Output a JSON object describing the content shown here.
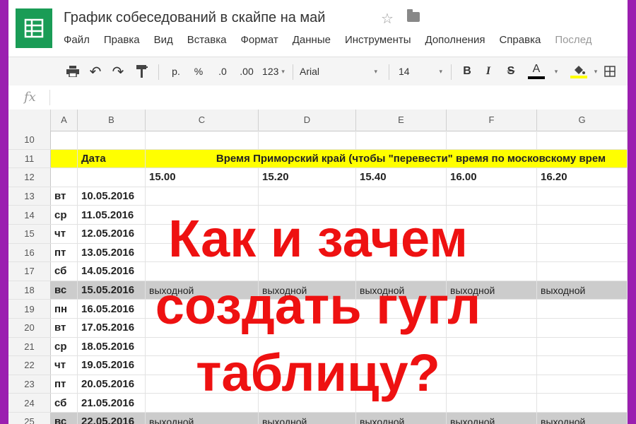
{
  "doc": {
    "title": "График собеседований в скайпе на май"
  },
  "menu": [
    "Файл",
    "Правка",
    "Вид",
    "Вставка",
    "Формат",
    "Данные",
    "Инструменты",
    "Дополнения",
    "Справка"
  ],
  "menu_last": "Послед",
  "toolbar": {
    "currency": "р.",
    "percent": "%",
    "dec_less": ".0",
    "dec_more": ".00",
    "number_format": "123",
    "font": "Arial",
    "font_size": "14",
    "bold": "B",
    "italic": "I",
    "strike": "S",
    "text_color": "A"
  },
  "formula_bar": {
    "fx": "fx"
  },
  "columns": [
    "A",
    "B",
    "C",
    "D",
    "E",
    "F",
    "G"
  ],
  "header_row": {
    "num": "11",
    "date_label": "Дата",
    "time_label": "Время Приморский край (чтобы \"перевести\" время по московскому врем"
  },
  "times_row": {
    "num": "12",
    "times": [
      "15.00",
      "15.20",
      "15.40",
      "16.00",
      "16.20"
    ]
  },
  "empty_row": {
    "num": "10"
  },
  "rows": [
    {
      "num": "13",
      "day": "вт",
      "date": "10.05.2016",
      "off": false
    },
    {
      "num": "14",
      "day": "ср",
      "date": "11.05.2016",
      "off": false
    },
    {
      "num": "15",
      "day": "чт",
      "date": "12.05.2016",
      "off": false
    },
    {
      "num": "16",
      "day": "пт",
      "date": "13.05.2016",
      "off": false
    },
    {
      "num": "17",
      "day": "сб",
      "date": "14.05.2016",
      "off": false
    },
    {
      "num": "18",
      "day": "вс",
      "date": "15.05.2016",
      "off": true
    },
    {
      "num": "19",
      "day": "пн",
      "date": "16.05.2016",
      "off": false
    },
    {
      "num": "20",
      "day": "вт",
      "date": "17.05.2016",
      "off": false
    },
    {
      "num": "21",
      "day": "ср",
      "date": "18.05.2016",
      "off": false
    },
    {
      "num": "22",
      "day": "чт",
      "date": "19.05.2016",
      "off": false
    },
    {
      "num": "23",
      "day": "пт",
      "date": "20.05.2016",
      "off": false
    },
    {
      "num": "24",
      "day": "сб",
      "date": "21.05.2016",
      "off": false
    },
    {
      "num": "25",
      "day": "вс",
      "date": "22.05.2016",
      "off": true
    }
  ],
  "day_off_label": "выходной",
  "overlay": {
    "line1": "Как и зачем",
    "line2": "создать гугл",
    "line3": "таблицу?"
  },
  "colors": {
    "brand": "#1a9c56",
    "highlight": "#ffff00",
    "overlay_text": "#ee1111",
    "day_off": "#cccccc"
  }
}
